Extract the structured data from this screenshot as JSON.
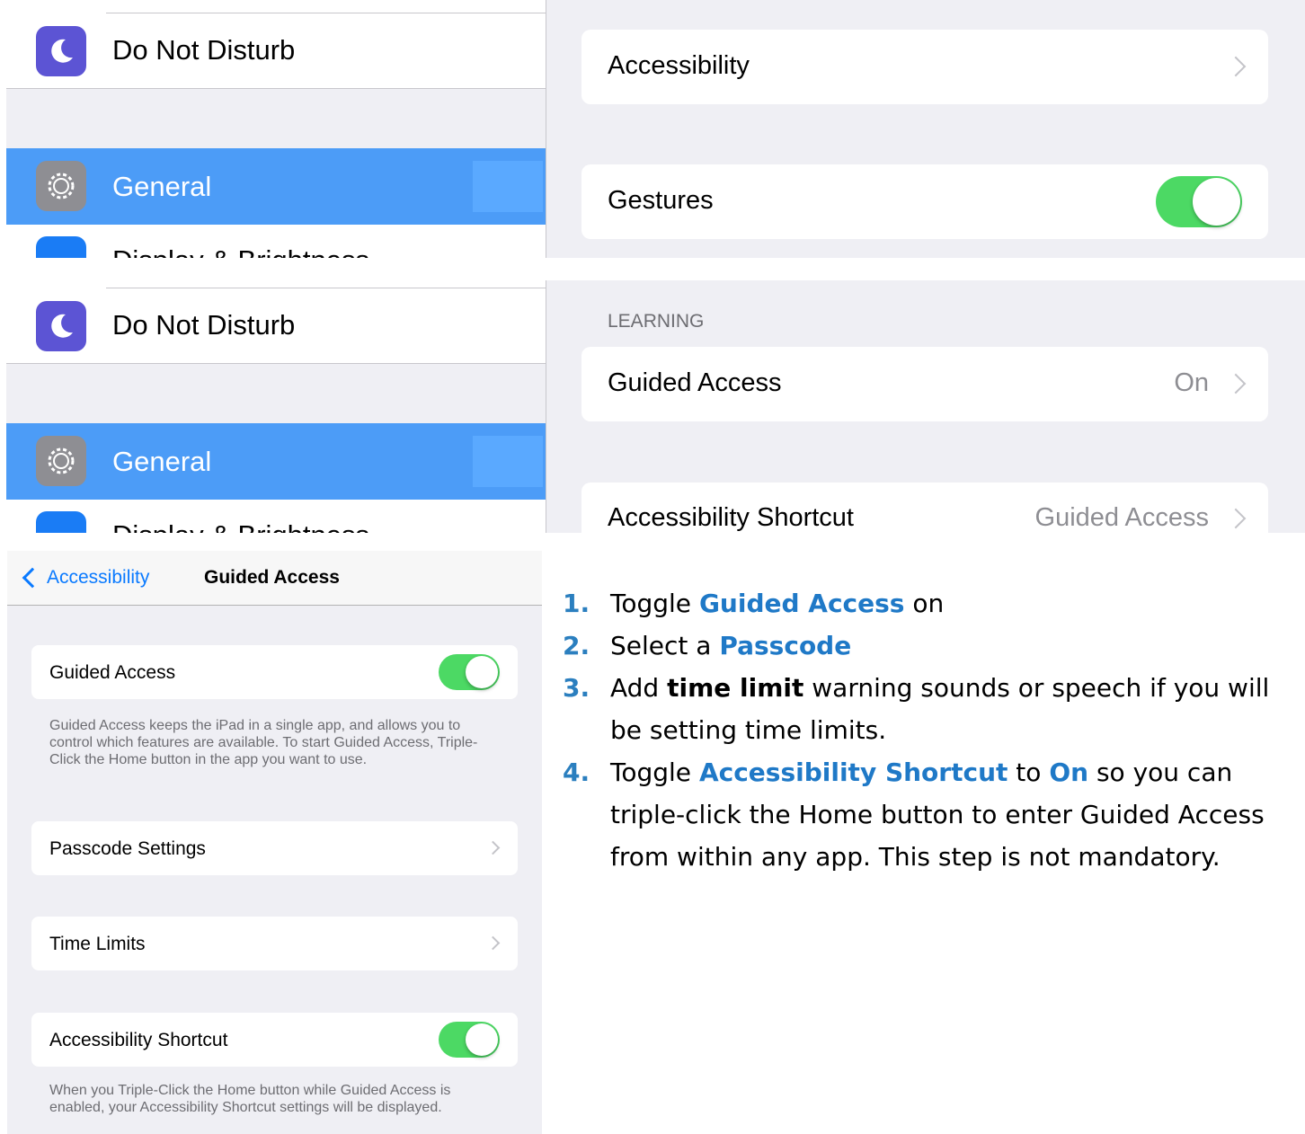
{
  "screenshot_1": {
    "sidebar": {
      "do_not_disturb": "Do Not Disturb",
      "general": "General",
      "display_cut": "Display & Brightness"
    },
    "detail": {
      "accessibility": "Accessibility",
      "gestures": "Gestures",
      "gestures_toggle": "on"
    }
  },
  "screenshot_2": {
    "sidebar": {
      "do_not_disturb": "Do Not Disturb",
      "general": "General",
      "display_cut": "Display & Brightness"
    },
    "detail": {
      "section_header": "LEARNING",
      "guided_access_label": "Guided Access",
      "guided_access_value": "On",
      "shortcut_label": "Accessibility Shortcut",
      "shortcut_value": "Guided Access"
    }
  },
  "guided_access_screen": {
    "nav": {
      "back_label": "Accessibility",
      "title": "Guided Access"
    },
    "guided_access_label": "Guided Access",
    "guided_access_toggle": "on",
    "guided_access_footnote": "Guided Access keeps the iPad in a single app, and allows you to control which features are available. To start Guided Access, Triple-Click the Home button in the app you want to use.",
    "passcode_settings": "Passcode Settings",
    "time_limits": "Time Limits",
    "shortcut_label": "Accessibility Shortcut",
    "shortcut_toggle": "on",
    "shortcut_footnote": "When you Triple-Click the Home button while Guided Access is enabled, your Accessibility Shortcut settings will be displayed."
  },
  "instructions": {
    "s1": {
      "num": "1.",
      "a": "Toggle",
      "b": "Guided Access",
      "c": "on"
    },
    "s2": {
      "num": "2.",
      "a": "Select a",
      "b": "Passcode"
    },
    "s3": {
      "num": "3.",
      "a": "Add",
      "b": "time limit",
      "c": "warning sounds or speech if you will be setting time limits."
    },
    "s4": {
      "num": "4.",
      "a": "Toggle",
      "b": "Accessibility Shortcut",
      "c": "to",
      "d": "On",
      "e": "so you can triple-click the Home button to enter Guided Access from within any app. This step is not mandatory."
    }
  },
  "colors": {
    "selected_row": "#4c9cf7",
    "toggle_on": "#4cd964",
    "link_blue": "#1f79c7",
    "dnd_icon": "#5c54d4",
    "gear_icon": "#8e8e93"
  }
}
